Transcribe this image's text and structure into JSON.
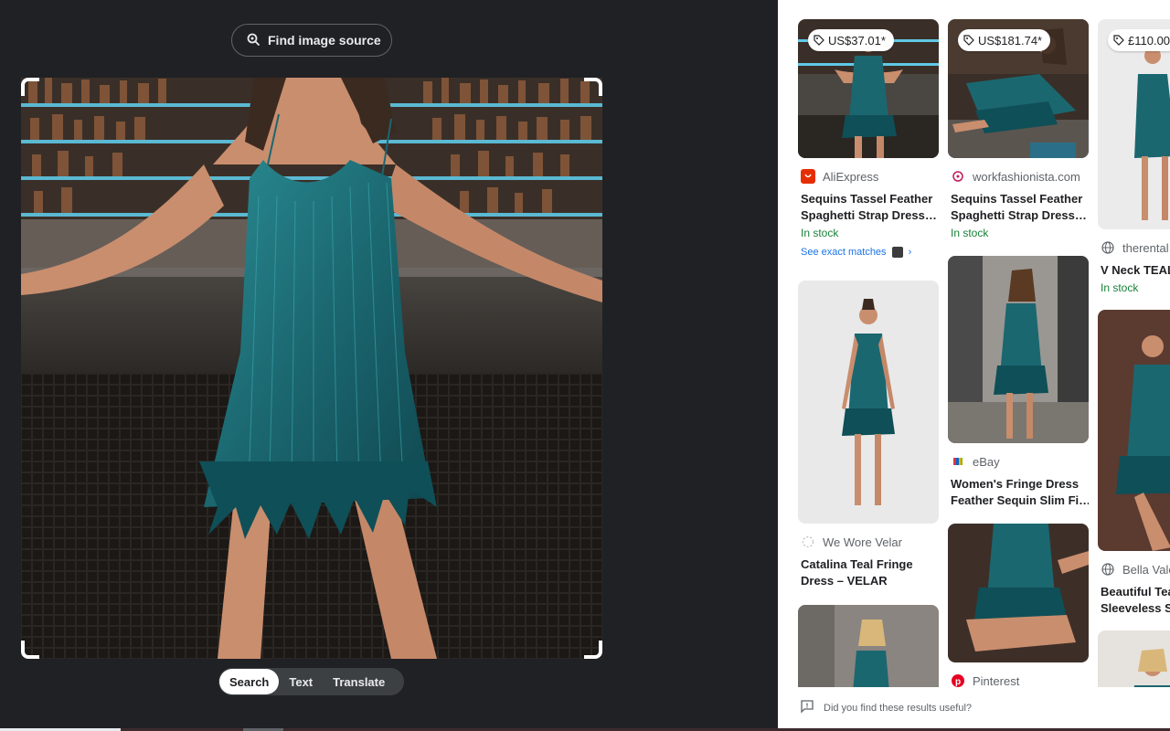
{
  "find_source": {
    "label": "Find image source",
    "icon": "lens-search-icon"
  },
  "modes": [
    {
      "label": "Search",
      "active": true
    },
    {
      "label": "Text",
      "active": false
    },
    {
      "label": "Translate",
      "active": false
    }
  ],
  "results": {
    "col1": [
      {
        "price": "US$37.01*",
        "source": "AliExpress",
        "title": "Sequins Tassel Feather",
        "title2": "Spaghetti Strap Dress…",
        "stock": "In stock",
        "exact": "See exact matches"
      },
      {
        "source": "We Wore Velar",
        "title": "Catalina Teal Fringe",
        "title2": "Dress – VELAR"
      }
    ],
    "col2": [
      {
        "price": "US$181.74*",
        "source": "workfashionista.com",
        "title": "Sequins Tassel Feather",
        "title2": "Spaghetti Strap Dress…",
        "stock": "In stock"
      },
      {
        "source": "eBay",
        "title": "Women's Fringe Dress",
        "title2": "Feather Sequin Slim Fi…"
      },
      {
        "source": "Pinterest"
      }
    ],
    "col3": [
      {
        "price": "£110.00",
        "source": "therental",
        "title": "V Neck TEAL",
        "stock": "In stock"
      },
      {
        "source": "Bella Vale",
        "title": "Beautiful Tea",
        "title2": "Sleeveless Se"
      }
    ]
  },
  "feedback": {
    "label": "Did you find these results useful?"
  },
  "colors": {
    "accent_blue": "#1a73e8",
    "stock_green": "#188038",
    "dark_bg": "#202124",
    "teal_dress": "#1f6f78"
  }
}
